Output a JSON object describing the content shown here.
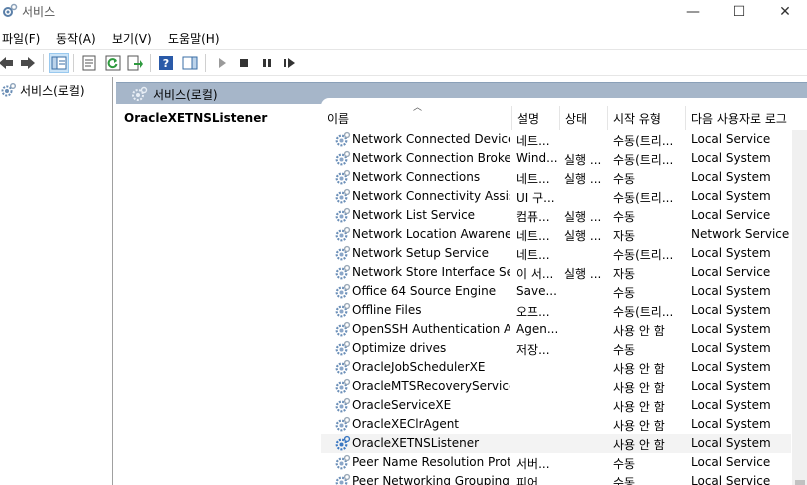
{
  "window": {
    "title": "서비스",
    "minimize_glyph": "—",
    "maximize_glyph": "☐",
    "close_glyph": "✕"
  },
  "menu": [
    "파일(F)",
    "동작(A)",
    "보기(V)",
    "도움말(H)"
  ],
  "toolbar": {
    "icons": [
      "back-icon",
      "forward-icon",
      "show-hide-console-tree-icon",
      "properties-icon",
      "refresh-icon",
      "export-list-icon",
      "help-icon",
      "show-action-pane-icon",
      "start-service-icon",
      "stop-service-icon",
      "pause-service-icon",
      "restart-service-icon"
    ]
  },
  "tree": {
    "root_label": "서비스(로컬)"
  },
  "pane_header": "서비스(로컬)",
  "detail_title": "OracleXETNSListener",
  "columns": [
    "이름",
    "설명",
    "상태",
    "시작 유형",
    "다음 사용자로 로그"
  ],
  "services": [
    {
      "name": "Network Connected Device...",
      "desc": "네트...",
      "status": "",
      "startup": "수동(트리...",
      "logon": "Local Service"
    },
    {
      "name": "Network Connection Broker",
      "desc": "Wind...",
      "status": "실행 ...",
      "startup": "수동(트리...",
      "logon": "Local System"
    },
    {
      "name": "Network Connections",
      "desc": "네트...",
      "status": "실행 ...",
      "startup": "수동",
      "logon": "Local System"
    },
    {
      "name": "Network Connectivity Assis...",
      "desc": "UI 구...",
      "status": "",
      "startup": "수동(트리...",
      "logon": "Local System"
    },
    {
      "name": "Network List Service",
      "desc": "컴퓨...",
      "status": "실행 ...",
      "startup": "수동",
      "logon": "Local Service"
    },
    {
      "name": "Network Location Awareness",
      "desc": "네트...",
      "status": "실행 ...",
      "startup": "자동",
      "logon": "Network Service"
    },
    {
      "name": "Network Setup Service",
      "desc": "네트...",
      "status": "",
      "startup": "수동(트리...",
      "logon": "Local System"
    },
    {
      "name": "Network Store Interface Se...",
      "desc": "이 서...",
      "status": "실행 ...",
      "startup": "자동",
      "logon": "Local Service"
    },
    {
      "name": "Office 64 Source Engine",
      "desc": "Save...",
      "status": "",
      "startup": "수동",
      "logon": "Local System"
    },
    {
      "name": "Offline Files",
      "desc": "오프...",
      "status": "",
      "startup": "수동(트리...",
      "logon": "Local System"
    },
    {
      "name": "OpenSSH Authentication A...",
      "desc": "Agen...",
      "status": "",
      "startup": "사용 안 함",
      "logon": "Local System"
    },
    {
      "name": "Optimize drives",
      "desc": "저장...",
      "status": "",
      "startup": "수동",
      "logon": "Local System"
    },
    {
      "name": "OracleJobSchedulerXE",
      "desc": "",
      "status": "",
      "startup": "사용 안 함",
      "logon": "Local System"
    },
    {
      "name": "OracleMTSRecoveryService",
      "desc": "",
      "status": "",
      "startup": "사용 안 함",
      "logon": "Local System"
    },
    {
      "name": "OracleServiceXE",
      "desc": "",
      "status": "",
      "startup": "사용 안 함",
      "logon": "Local System"
    },
    {
      "name": "OracleXEClrAgent",
      "desc": "",
      "status": "",
      "startup": "사용 안 함",
      "logon": "Local System"
    },
    {
      "name": "OracleXETNSListener",
      "desc": "",
      "status": "",
      "startup": "사용 안 함",
      "logon": "Local System",
      "selected": true
    },
    {
      "name": "Peer Name Resolution Prot...",
      "desc": "서버...",
      "status": "",
      "startup": "수동",
      "logon": "Local Service"
    },
    {
      "name": "Peer Networking Grouping",
      "desc": "피어...",
      "status": "",
      "startup": "수동",
      "logon": "Local Service"
    }
  ],
  "colors": {
    "pane_header_bg": "#a6b6c9",
    "selected_row_bg": "#f3f3f3",
    "gear_blue": "#3b78c2"
  }
}
